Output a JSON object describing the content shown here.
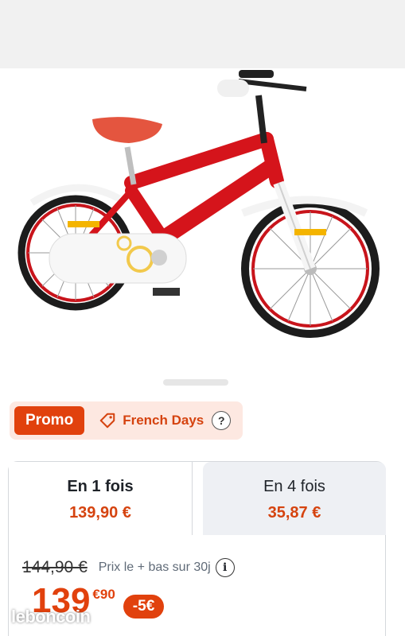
{
  "promo": {
    "badge": "Promo",
    "event_label": "French Days",
    "help_icon": "question-circle-icon"
  },
  "payment_tabs": [
    {
      "title": "En 1 fois",
      "price": "139,90 €",
      "selected": true
    },
    {
      "title": "En 4 fois",
      "price": "35,87 €",
      "selected": false
    }
  ],
  "pricing": {
    "old_price": "144,90 €",
    "reference_label": "Prix le + bas sur 30j",
    "price_integer": "139",
    "price_decimal": "€90",
    "discount": "-5€"
  },
  "watermark": "leboncoin",
  "colors": {
    "accent": "#e1410d",
    "promo_bg": "#fde8e1",
    "bike_red": "#d5141b",
    "tab_inactive_bg": "#eef0f4"
  }
}
